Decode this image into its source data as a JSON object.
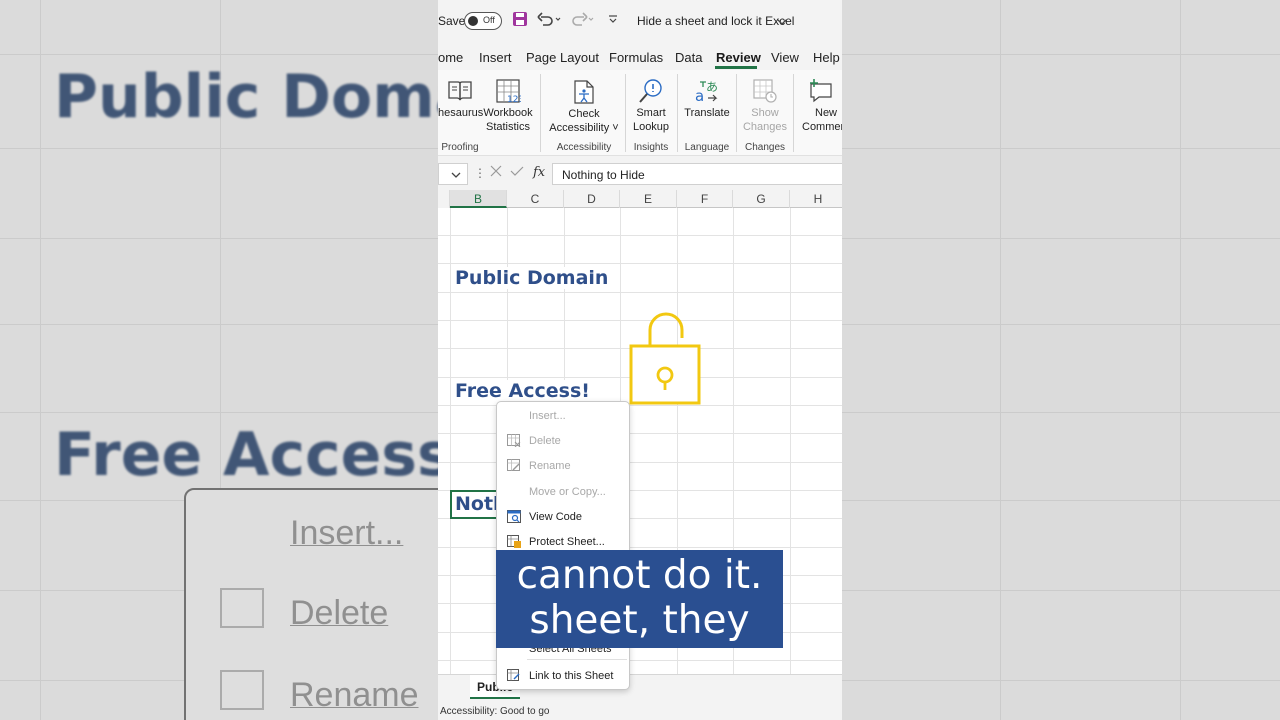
{
  "background": {
    "big_text_1": "Public Doma",
    "big_text_2": "Free Access!",
    "menu_item_1": "Insert...",
    "menu_item_2": "Delete",
    "menu_item_3": "Rename"
  },
  "titlebar": {
    "autosave_label": "Save",
    "toggle_label": "Off",
    "doc_title": "Hide a sheet and lock it Excel"
  },
  "tabs": [
    "ome",
    "Insert",
    "Page Layout",
    "Formulas",
    "Data",
    "Review",
    "View",
    "Help"
  ],
  "active_tab": "Review",
  "ribbon": {
    "thesaurus": "hesaurus",
    "workbook_statistics_1": "Workbook",
    "workbook_statistics_2": "Statistics",
    "check_accessibility_1": "Check",
    "check_accessibility_2": "Accessibility",
    "smart_lookup_1": "Smart",
    "smart_lookup_2": "Lookup",
    "translate": "Translate",
    "show_changes_1": "Show",
    "show_changes_2": "Changes",
    "new_comment_1": "New",
    "new_comment_2": "Commen",
    "groups": {
      "proofing": "Proofing",
      "accessibility": "Accessibility",
      "insights": "Insights",
      "language": "Language",
      "changes": "Changes"
    }
  },
  "formula_bar": {
    "fx": "fx",
    "value": "Nothing to Hide"
  },
  "columns": [
    "B",
    "C",
    "D",
    "E",
    "F",
    "G",
    "H"
  ],
  "selected_column": "B",
  "cells": {
    "public_domain": "Public Domain",
    "free_access": "Free Access!",
    "nothing_partial": "Noth"
  },
  "lock_color": "#f2c811",
  "context_menu": [
    {
      "label": "Insert...",
      "disabled": true,
      "icon": "none"
    },
    {
      "label": "Delete",
      "disabled": true,
      "icon": "delete-sheet-icon"
    },
    {
      "label": "Rename",
      "disabled": true,
      "icon": "rename-sheet-icon"
    },
    {
      "label": "Move or Copy...",
      "disabled": true,
      "icon": "none"
    },
    {
      "label": "View Code",
      "disabled": false,
      "icon": "view-code-icon"
    },
    {
      "label": "Protect Sheet...",
      "disabled": false,
      "icon": "protect-sheet-icon"
    },
    {
      "label": "Select All Sheets",
      "disabled": false,
      "icon": "none"
    },
    {
      "label": "Link to this Sheet",
      "disabled": false,
      "icon": "link-sheet-icon"
    }
  ],
  "caption": {
    "line1": "cannot do it.",
    "line2": "sheet, they"
  },
  "sheet_tab": "Public",
  "status_bar": "Accessibility: Good to go"
}
